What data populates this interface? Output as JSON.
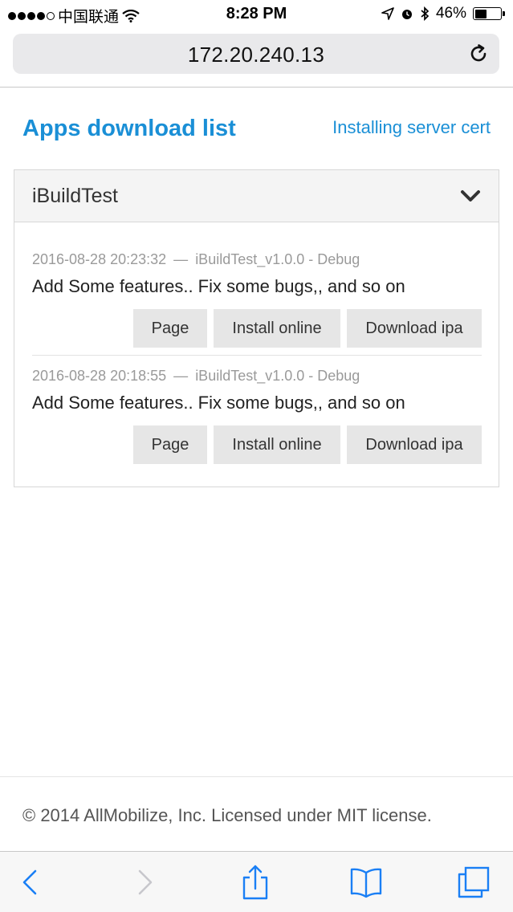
{
  "status_bar": {
    "carrier": "中国联通",
    "time": "8:28 PM",
    "battery_percent": "46%",
    "battery_level": 0.46,
    "icons": [
      "wifi-icon",
      "location-icon",
      "alarm-icon",
      "bluetooth-icon",
      "battery-icon"
    ]
  },
  "browser": {
    "address": "172.20.240.13",
    "reload_icon": "reload-icon"
  },
  "header": {
    "title": "Apps download list",
    "cert_link": "Installing server cert"
  },
  "panel": {
    "title": "iBuildTest",
    "toggle_icon": "chevron-down-icon",
    "builds": [
      {
        "date": "2016-08-28 20:23:32",
        "separator": "—",
        "name": "iBuildTest_v1.0.0 - Debug",
        "description": "Add Some features.. Fix some bugs,, and so on",
        "actions": [
          "Page",
          "Install online",
          "Download ipa"
        ]
      },
      {
        "date": "2016-08-28 20:18:55",
        "separator": "—",
        "name": "iBuildTest_v1.0.0 - Debug",
        "description": "Add Some features.. Fix some bugs,, and so on",
        "actions": [
          "Page",
          "Install online",
          "Download ipa"
        ]
      }
    ]
  },
  "footer": {
    "text": "© 2014 AllMobilize, Inc. Licensed under MIT license."
  },
  "toolbar": {
    "icons": [
      "back-icon",
      "forward-icon",
      "share-icon",
      "bookmarks-icon",
      "tabs-icon"
    ]
  },
  "colors": {
    "accent": "#1a8fd6",
    "ios_blue": "#1a7ff5",
    "disabled": "#c7c7cc"
  }
}
